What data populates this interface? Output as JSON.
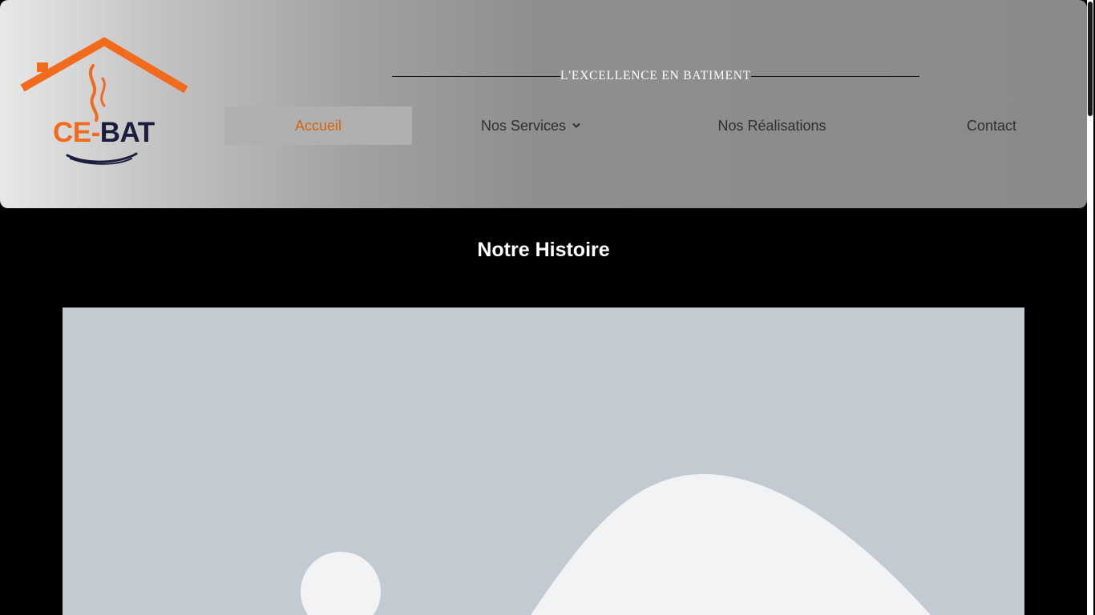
{
  "logo": {
    "ce": "CE-",
    "bat": "BAT",
    "colors": {
      "orange": "#f26a1b",
      "navy": "#1c1d3c"
    }
  },
  "header": {
    "tagline": "L'EXCELLENCE EN BATIMENT"
  },
  "nav": {
    "items": [
      {
        "label": "Accueil",
        "active": true
      },
      {
        "label": "Nos Services",
        "has_dropdown": true,
        "icon": "chevron-down-icon"
      },
      {
        "label": "Nos Réalisations"
      },
      {
        "label": "Contact"
      }
    ],
    "accent_color": "#d4650f"
  },
  "main": {
    "section_title": "Notre Histoire",
    "image_icon": "image-placeholder-icon"
  }
}
